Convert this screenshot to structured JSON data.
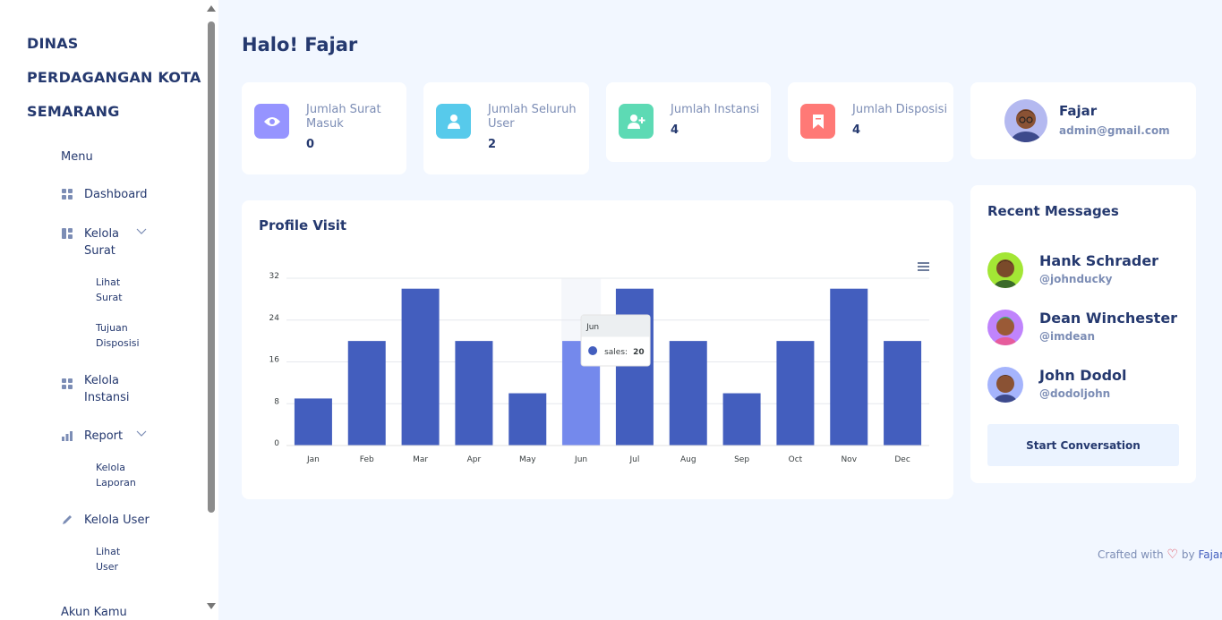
{
  "sidebar": {
    "brand": [
      "DINAS",
      "PERDAGANGAN KOTA",
      "SEMARANG"
    ],
    "menu_title": "Menu",
    "items": {
      "dashboard": "Dashboard",
      "kelola_surat": [
        "Kelola",
        "Surat"
      ],
      "lihat_surat": [
        "Lihat",
        "Surat"
      ],
      "tujuan_disposisi": [
        "Tujuan",
        "Disposisi"
      ],
      "kelola_instansi": [
        "Kelola",
        "Instansi"
      ],
      "report": "Report",
      "kelola_laporan": [
        "Kelola",
        "Laporan"
      ],
      "kelola_user": "Kelola User",
      "lihat_user": [
        "Lihat",
        "User"
      ],
      "akun_kamu": "Akun Kamu"
    }
  },
  "header": {
    "greeting": "Halo! Fajar"
  },
  "stats": [
    {
      "label": "Jumlah Surat Masuk",
      "value": "0",
      "color": "#9694ff",
      "icon": "eye-icon"
    },
    {
      "label": "Jumlah Seluruh User",
      "value": "2",
      "color": "#57caeb",
      "icon": "user-icon"
    },
    {
      "label": "Jumlah Instansi",
      "value": "4",
      "color": "#5ddab4",
      "icon": "user-plus-icon"
    },
    {
      "label": "Jumlah Disposisi",
      "value": "4",
      "color": "#ff7976",
      "icon": "bookmark-icon"
    }
  ],
  "profile": {
    "name": "Fajar",
    "email": "admin@gmail.com"
  },
  "chart": {
    "title": "Profile Visit"
  },
  "chart_data": {
    "type": "bar",
    "categories": [
      "Jan",
      "Feb",
      "Mar",
      "Apr",
      "May",
      "Jun",
      "Jul",
      "Aug",
      "Sep",
      "Oct",
      "Nov",
      "Dec"
    ],
    "series": [
      {
        "name": "sales",
        "values": [
          9,
          20,
          30,
          20,
          10,
          20,
          30,
          20,
          10,
          20,
          30,
          20
        ]
      }
    ],
    "ylim": [
      0,
      32
    ],
    "yticks": [
      "0",
      "8",
      "16",
      "24",
      "32"
    ],
    "color": "#435ebe",
    "highlight_color": "#7489ec",
    "grid": true,
    "tooltip": {
      "title": "Jun",
      "label": "sales:",
      "value": "20"
    }
  },
  "messages": {
    "title": "Recent Messages",
    "items": [
      {
        "name": "Hank Schrader",
        "handle": "@johnducky",
        "bg": "#a3e635"
      },
      {
        "name": "Dean Winchester",
        "handle": "@imdean",
        "bg": "#c084fc"
      },
      {
        "name": "John Dodol",
        "handle": "@dodoljohn",
        "bg": "#a5b4fc"
      }
    ],
    "button": "Start Conversation"
  },
  "footer": {
    "text": "Crafted with",
    "heart": "♡",
    "by": "by",
    "author": "Fajar"
  }
}
